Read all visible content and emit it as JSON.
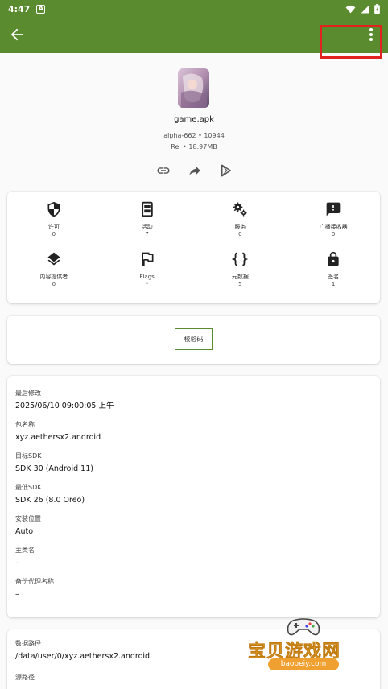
{
  "status_bar": {
    "time": "4:47",
    "notif_icon": "A"
  },
  "app": {
    "name": "game.apk",
    "version": "alpha-662 • 10944",
    "release": "Rel • 18.97MB"
  },
  "actions": [
    "link-icon",
    "share-icon",
    "play-store-icon"
  ],
  "grid": [
    {
      "label": "许可",
      "count": "0",
      "icon": "shield-icon"
    },
    {
      "label": "活动",
      "count": "7",
      "icon": "activity-icon"
    },
    {
      "label": "服务",
      "count": "0",
      "icon": "gears-icon"
    },
    {
      "label": "广播接收器",
      "count": "0",
      "icon": "alert-message-icon"
    },
    {
      "label": "内容提供者",
      "count": "0",
      "icon": "layers-icon"
    },
    {
      "label": "Flags",
      "count": "*",
      "icon": "flag-icon"
    },
    {
      "label": "元数据",
      "count": "5",
      "icon": "braces-icon"
    },
    {
      "label": "签名",
      "count": "1",
      "icon": "lock-icon"
    }
  ],
  "verify_button": "校验码",
  "info": [
    {
      "key": "最后修改",
      "value": "2025/06/10 09:00:05 上午"
    },
    {
      "key": "包名称",
      "value": "xyz.aethersx2.android"
    },
    {
      "key": "目标SDK",
      "value": "SDK 30 (Android 11)"
    },
    {
      "key": "最低SDK",
      "value": "SDK 26 (8.0 Oreo)"
    },
    {
      "key": "安装位置",
      "value": "Auto"
    },
    {
      "key": "主类名",
      "value": "–"
    },
    {
      "key": "备份代理名称",
      "value": "–"
    }
  ],
  "paths": [
    {
      "key": "数据路径",
      "value": "/data/user/0/xyz.aethersx2.android"
    },
    {
      "key": "源路径",
      "value": ""
    }
  ],
  "watermark": {
    "text": "宝贝游戏网",
    "url": "baobeiy.com"
  },
  "colors": {
    "app_bar": "#5a8b2e",
    "highlight": "#e0231f"
  }
}
